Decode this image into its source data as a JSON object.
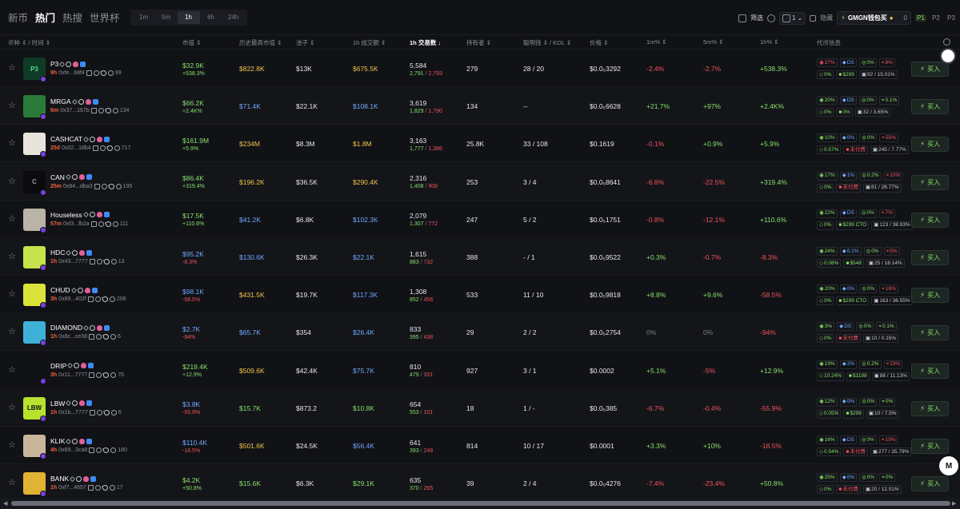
{
  "nav": {
    "tabs": [
      {
        "label": "新币"
      },
      {
        "label": "热门"
      },
      {
        "label": "热搜"
      },
      {
        "label": "世界杯"
      }
    ],
    "active_tab": "热门",
    "timeframes": [
      "1m",
      "5m",
      "1h",
      "6h",
      "24h"
    ],
    "active_timeframe": "1h"
  },
  "toolbar": {
    "filter_label": "筛选",
    "select_value": "1",
    "checkbox_label": "隐藏",
    "wallet_label": "GMGN钱包买",
    "wallet_amount": "0",
    "pages": [
      "P1",
      "P2",
      "P3"
    ],
    "active_page": "P1"
  },
  "columns": {
    "token": "币种 ⇕ / 时间 ⇕",
    "mcap": "市值 ⇕",
    "ath": "历史最高市值 ⇕",
    "pool": "池子 ⇕",
    "vol": "1h 成交额 ⇕",
    "txs": "1h 交易数 ↓",
    "holders": "持有者 ⇕",
    "smart": "聪明钱 ⇕ / KOL ⇕",
    "price": "价格 ⇕",
    "m1": "1m% ⇕",
    "m5": "5m% ⇕",
    "h1": "1h% ⇕",
    "info": "代币信息"
  },
  "buy_label": "买入",
  "colors": {
    "green": "#86e06b",
    "red": "#f0525e",
    "blue": "#6fa8ff",
    "yellow": "#f0c34b"
  },
  "rows": [
    {
      "name": "P3",
      "age": "9h",
      "addr": "0xfe...68f4",
      "views": "99",
      "avatar_text": "P3",
      "avatar_bg": "#0f3b26",
      "avatar_fg": "#4ae08a",
      "mcap": "$32.9K",
      "mcap_chg": "+538.3%",
      "mcap_chg_color": "green",
      "ath": "$822.8K",
      "ath_color": "yellow",
      "pool": "$13K",
      "vol": "$675.5K",
      "vol_color": "yellow",
      "txs": "5,584",
      "buys": "2,791",
      "sells": "2,793",
      "holders": "279",
      "smart": "28 / 20",
      "price": "$0.0₅3292",
      "m1": "-2.4%",
      "m1_color": "red",
      "m5": "-2.7%",
      "m5_color": "red",
      "h1": "+538.3%",
      "h1_color": "green",
      "i1": "37%",
      "i1c": "r",
      "i2": "DS",
      "i3": "0%",
      "i4": "8%",
      "i4c": "r",
      "i5": "0%",
      "i6": "$299",
      "i7": "92 / 15.01%"
    },
    {
      "name": "MRGA",
      "age": "6m",
      "addr": "0x37...167b",
      "views": "134",
      "avatar_text": "",
      "avatar_bg": "#2c7a3a",
      "avatar_fg": "#111",
      "mcap": "$66.2K",
      "mcap_chg": "+2.4K%",
      "mcap_chg_color": "green",
      "ath": "$71.4K",
      "ath_color": "blue",
      "pool": "$22.1K",
      "vol": "$108.1K",
      "vol_color": "blue",
      "txs": "3,619",
      "buys": "1,829",
      "sells": "1,790",
      "holders": "134",
      "smart": "--",
      "price": "$0.0₅6628",
      "m1": "+21.7%",
      "m1_color": "green",
      "m5": "+97%",
      "m5_color": "green",
      "h1": "+2.4K%",
      "h1_color": "green",
      "i1": "20%",
      "i1c": "g",
      "i2": "DS",
      "i3": "0%",
      "i4": "0.1%",
      "i4c": "g",
      "i5": "0%",
      "i6": "0%",
      "i7": "32 / 3.65%"
    },
    {
      "name": "CASHCAT",
      "age": "25d",
      "addr": "0x02...18b4",
      "views": "717",
      "avatar_text": "",
      "avatar_bg": "#e8e4dc",
      "avatar_fg": "#111",
      "mcap": "$161.9M",
      "mcap_chg": "+5.9%",
      "mcap_chg_color": "green",
      "ath": "$234M",
      "ath_color": "yellow",
      "pool": "$8.3M",
      "vol": "$1.8M",
      "vol_color": "yellow",
      "txs": "3,163",
      "buys": "1,777",
      "sells": "1,386",
      "holders": "25.8K",
      "smart": "33 / 108",
      "price": "$0.1619",
      "m1": "-0.1%",
      "m1_color": "red",
      "m5": "+0.9%",
      "m5_color": "green",
      "h1": "+5.9%",
      "h1_color": "green",
      "i1": "10%",
      "i1c": "g",
      "i2": "0%",
      "i3": "0%",
      "i4": "55%",
      "i4c": "r",
      "i5": "0.57%",
      "i6": "未付费",
      "i7": "245 / 7.77%"
    },
    {
      "name": "CAN",
      "age": "25m",
      "addr": "0x84...dba3",
      "views": "195",
      "avatar_text": "C",
      "avatar_bg": "#0b0b0d",
      "avatar_fg": "#9a9da5",
      "mcap": "$86.4K",
      "mcap_chg": "+319.4%",
      "mcap_chg_color": "green",
      "ath": "$196.2K",
      "ath_color": "yellow",
      "pool": "$36.5K",
      "vol": "$290.4K",
      "vol_color": "yellow",
      "txs": "2,316",
      "buys": "1,408",
      "sells": "908",
      "holders": "253",
      "smart": "3 / 4",
      "price": "$0.0₅8641",
      "m1": "-6.8%",
      "m1_color": "red",
      "m5": "-22.5%",
      "m5_color": "red",
      "h1": "+319.4%",
      "h1_color": "green",
      "i1": "17%",
      "i1c": "g",
      "i2": "1%",
      "i3": "0.2%",
      "i4": "10%",
      "i4c": "r",
      "i5": "0%",
      "i6": "未付费",
      "i7": "81 / 26.77%"
    },
    {
      "name": "Houseless",
      "age": "57m",
      "addr": "0xf3...fb2a",
      "views": "111",
      "avatar_text": "",
      "avatar_bg": "#b9b3a8",
      "avatar_fg": "#111",
      "mcap": "$17.5K",
      "mcap_chg": "+110.6%",
      "mcap_chg_color": "green",
      "ath": "$41.2K",
      "ath_color": "blue",
      "pool": "$6.8K",
      "vol": "$102.3K",
      "vol_color": "blue",
      "txs": "2,079",
      "buys": "1,307",
      "sells": "772",
      "holders": "247",
      "smart": "5 / 2",
      "price": "$0.0₅1751",
      "m1": "-0.8%",
      "m1_color": "red",
      "m5": "-12.1%",
      "m5_color": "red",
      "h1": "+110.6%",
      "h1_color": "green",
      "i1": "22%",
      "i1c": "g",
      "i2": "DS",
      "i3": "0%",
      "i4": "7%",
      "i4c": "r",
      "i5": "0%",
      "i6": "$299 CTO",
      "i7": "123 / 38.93%"
    },
    {
      "name": "HDC",
      "age": "1h",
      "addr": "0x43...7777",
      "views": "13",
      "avatar_text": "",
      "avatar_bg": "#c7e24a",
      "avatar_fg": "#111",
      "mcap": "$95.2K",
      "mcap_chg": "-8.3%",
      "mcap_chg_color": "red",
      "ath": "$130.6K",
      "ath_color": "blue",
      "pool": "$26.3K",
      "vol": "$22.1K",
      "vol_color": "blue",
      "txs": "1,615",
      "buys": "883",
      "sells": "732",
      "holders": "388",
      "smart": "- / 1",
      "price": "$0.0₅9522",
      "m1": "+0.3%",
      "m1_color": "green",
      "m5": "-0.7%",
      "m5_color": "red",
      "h1": "-8.3%",
      "h1_color": "red",
      "i1": "24%",
      "i1c": "g",
      "i2": "0.1%",
      "i3": "0%",
      "i4": "5%",
      "i4c": "r",
      "i5": "0.08%",
      "i6": "$548",
      "i7": "25 / 18.14%"
    },
    {
      "name": "CHUD",
      "age": "3h",
      "addr": "0x89...402f",
      "views": "206",
      "avatar_text": "",
      "avatar_bg": "#d9e33a",
      "avatar_fg": "#111",
      "mcap": "$98.1K",
      "mcap_chg": "-58.5%",
      "mcap_chg_color": "red",
      "ath": "$431.5K",
      "ath_color": "yellow",
      "pool": "$19.7K",
      "vol": "$117.3K",
      "vol_color": "blue",
      "txs": "1,308",
      "buys": "852",
      "sells": "456",
      "holders": "533",
      "smart": "11 / 10",
      "price": "$0.0₅9818",
      "m1": "+8.8%",
      "m1_color": "green",
      "m5": "+9.6%",
      "m5_color": "green",
      "h1": "-58.5%",
      "h1_color": "red",
      "i1": "20%",
      "i1c": "g",
      "i2": "0%",
      "i3": "0%",
      "i4": "18%",
      "i4c": "r",
      "i5": "0%",
      "i6": "$299 CTO",
      "i7": "163 / 36.55%"
    },
    {
      "name": "DIAMOND",
      "age": "1h",
      "addr": "0x8c...ce38",
      "views": "6",
      "avatar_text": "",
      "avatar_bg": "#3fb1d9",
      "avatar_fg": "#111",
      "mcap": "$2.7K",
      "mcap_chg": "-94%",
      "mcap_chg_color": "red",
      "ath": "$65.7K",
      "ath_color": "blue",
      "pool": "$354",
      "vol": "$26.4K",
      "vol_color": "blue",
      "txs": "833",
      "buys": "395",
      "sells": "438",
      "holders": "29",
      "smart": "2 / 2",
      "price": "$0.0₅2754",
      "m1": "0%",
      "m1_color": "gray",
      "m5": "0%",
      "m5_color": "gray",
      "h1": "-94%",
      "h1_color": "red",
      "i1": "3%",
      "i1c": "g",
      "i2": "DS",
      "i3": "0%",
      "i4": "0.1%",
      "i4c": "g",
      "i5": "0%",
      "i6": "未付费",
      "i7": "10 / 0.15%"
    },
    {
      "name": "DRIP",
      "age": "3h",
      "addr": "0x11...7777",
      "views": "76",
      "avatar_text": "",
      "avatar_bg": "#101114",
      "avatar_fg": "#fff",
      "mcap": "$219.4K",
      "mcap_chg": "+12.9%",
      "mcap_chg_color": "green",
      "ath": "$509.6K",
      "ath_color": "yellow",
      "pool": "$42.4K",
      "vol": "$75.7K",
      "vol_color": "blue",
      "txs": "810",
      "buys": "479",
      "sells": "331",
      "holders": "927",
      "smart": "3 / 1",
      "price": "$0.0002",
      "m1": "+5.1%",
      "m1_color": "green",
      "m5": "-5%",
      "m5_color": "red",
      "h1": "+12.9%",
      "h1_color": "green",
      "i1": "19%",
      "i1c": "g",
      "i2": "2%",
      "i3": "0.2%",
      "i4": "23%",
      "i4c": "r",
      "i5": "10.24%",
      "i6": "$1198",
      "i7": "88 / 11.13%"
    },
    {
      "name": "LBW",
      "age": "1h",
      "addr": "0x1b...7777",
      "views": "6",
      "avatar_text": "LBW",
      "avatar_bg": "#b7e22e",
      "avatar_fg": "#111",
      "mcap": "$3.8K",
      "mcap_chg": "-55.9%",
      "mcap_chg_color": "red",
      "ath": "$15.7K",
      "ath_color": "green",
      "pool": "$873.2",
      "vol": "$10.8K",
      "vol_color": "green",
      "txs": "654",
      "buys": "553",
      "sells": "101",
      "holders": "18",
      "smart": "1 / -",
      "price": "$0.0₅385",
      "m1": "-6.7%",
      "m1_color": "red",
      "m5": "-0.4%",
      "m5_color": "red",
      "h1": "-55.9%",
      "h1_color": "red",
      "i1": "12%",
      "i1c": "g",
      "i2": "0%",
      "i3": "0%",
      "i4": "0%",
      "i4c": "g",
      "i5": "0.05%",
      "i6": "$299",
      "i7": "10 / 7.5%"
    },
    {
      "name": "KLIK",
      "age": "4h",
      "addr": "0x69...3ca8",
      "views": "180",
      "avatar_text": "",
      "avatar_bg": "#c9b59a",
      "avatar_fg": "#111",
      "mcap": "$110.4K",
      "mcap_chg": "-18.5%",
      "mcap_chg_color": "red",
      "ath": "$501.6K",
      "ath_color": "yellow",
      "pool": "$24.5K",
      "vol": "$56.4K",
      "vol_color": "blue",
      "txs": "641",
      "buys": "393",
      "sells": "248",
      "holders": "814",
      "smart": "10 / 17",
      "price": "$0.0001",
      "m1": "+3.3%",
      "m1_color": "green",
      "m5": "+10%",
      "m5_color": "green",
      "h1": "-18.5%",
      "h1_color": "red",
      "i1": "16%",
      "i1c": "g",
      "i2": "DS",
      "i3": "0%",
      "i4": "19%",
      "i4c": "r",
      "i5": "0.54%",
      "i6": "未付费",
      "i7": "277 / 35.79%"
    },
    {
      "name": "BANK",
      "age": "1h",
      "addr": "0xf7...4657",
      "views": "17",
      "avatar_text": "",
      "avatar_bg": "#e2b233",
      "avatar_fg": "#111",
      "mcap": "$4.2K",
      "mcap_chg": "+50.8%",
      "mcap_chg_color": "green",
      "ath": "$15.6K",
      "ath_color": "green",
      "pool": "$6.3K",
      "vol": "$29.1K",
      "vol_color": "green",
      "txs": "635",
      "buys": "370",
      "sells": "265",
      "holders": "39",
      "smart": "2 / 4",
      "price": "$0.0₅4276",
      "m1": "-7.4%",
      "m1_color": "red",
      "m5": "-23.4%",
      "m5_color": "red",
      "h1": "+50.8%",
      "h1_color": "green",
      "i1": "25%",
      "i1c": "g",
      "i2": "0%",
      "i3": "0%",
      "i4": "0%",
      "i4c": "g",
      "i5": "0%",
      "i6": "未付费",
      "i7": "20 / 12.01%"
    }
  ]
}
